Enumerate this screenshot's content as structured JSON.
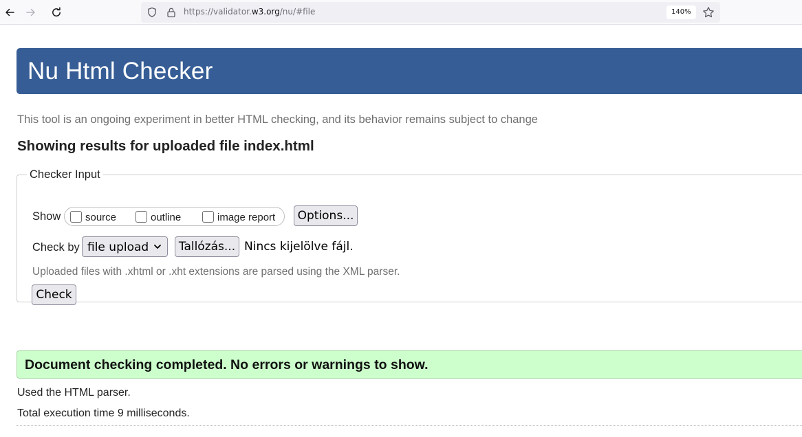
{
  "browser": {
    "url_prefix": "https://validator.",
    "url_host": "w3.org",
    "url_suffix": "/nu/#file",
    "zoom": "140%",
    "icons": [
      "back-arrow-icon",
      "forward-arrow-icon",
      "reload-icon",
      "shield-icon",
      "lock-icon",
      "star-icon"
    ]
  },
  "header": {
    "title": "Nu Html Checker"
  },
  "tagline": "This tool is an ongoing experiment in better HTML checking, and its behavior remains subject to change",
  "results_heading": "Showing results for uploaded file index.html",
  "checker_input": {
    "legend": "Checker Input",
    "show_label": "Show",
    "show_options": [
      {
        "label": "source",
        "checked": false
      },
      {
        "label": "outline",
        "checked": false
      },
      {
        "label": "image report",
        "checked": false
      }
    ],
    "options_button": "Options...",
    "check_by_label": "Check by",
    "check_by_selected": "file upload",
    "browse_button": "Tallózás...",
    "file_status": "Nincs kijelölve fájl.",
    "xml_note": "Uploaded files with .xhtml or .xht extensions are parsed using the XML parser.",
    "check_button": "Check"
  },
  "results": {
    "success_message": "Document checking completed. No errors or warnings to show.",
    "parser_info": "Used the HTML parser.",
    "execution_time": "Total execution time 9 milliseconds."
  },
  "colors": {
    "banner": "#365d95",
    "success_bg": "#ccffcc",
    "button_bg": "#e9e9ed"
  }
}
